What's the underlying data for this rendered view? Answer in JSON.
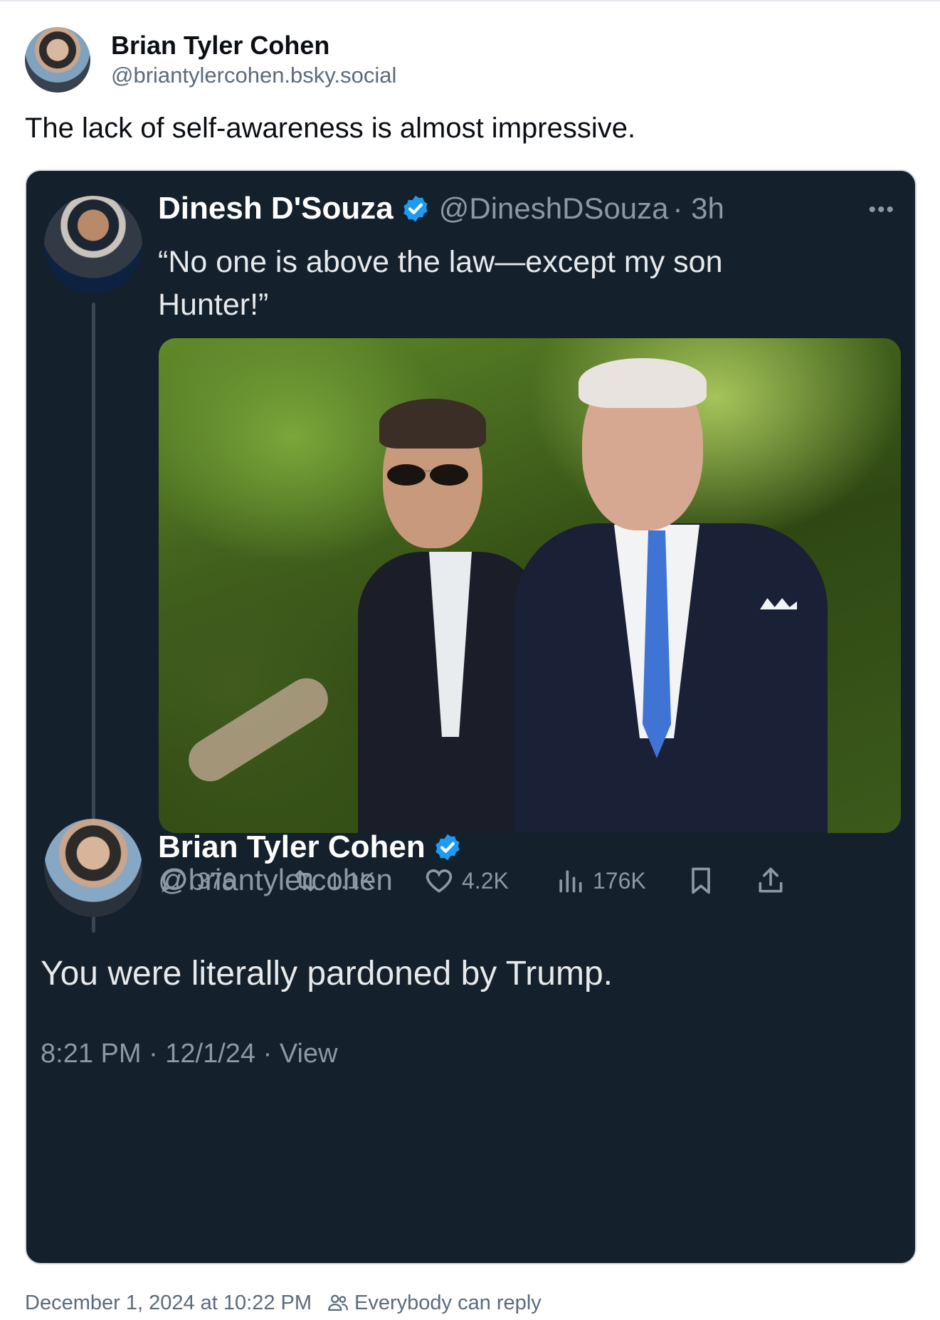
{
  "post": {
    "author_name": "Brian Tyler Cohen",
    "author_handle": "@briantylercohen.bsky.social",
    "text": "The lack of self-awareness is almost impressive.",
    "timestamp": "December 1, 2024 at 10:22 PM",
    "reply_setting": "Everybody can reply"
  },
  "embed": {
    "original": {
      "author_name": "Dinesh D'Souza",
      "author_handle": "@DineshDSouza",
      "time": "· 3h",
      "more": "•••",
      "text": "“No one is above the law—except my son Hunter!”",
      "metrics": {
        "replies": "376",
        "reposts": "1.1K",
        "likes": "4.2K",
        "views": "176K"
      }
    },
    "reply": {
      "author_name": "Brian Tyler Cohen",
      "author_handle": "@briantylercohen",
      "text": "You were literally pardoned by Trump.",
      "meta": "8:21 PM · 12/1/24 · View"
    }
  },
  "colors": {
    "card_bg": "#14202c",
    "verified_blue": "#1d9bf0",
    "muted": "#8b98a5"
  },
  "icons": [
    "reply-icon",
    "repost-icon",
    "like-icon",
    "views-icon",
    "bookmark-icon",
    "share-icon",
    "verified-icon",
    "people-icon"
  ]
}
